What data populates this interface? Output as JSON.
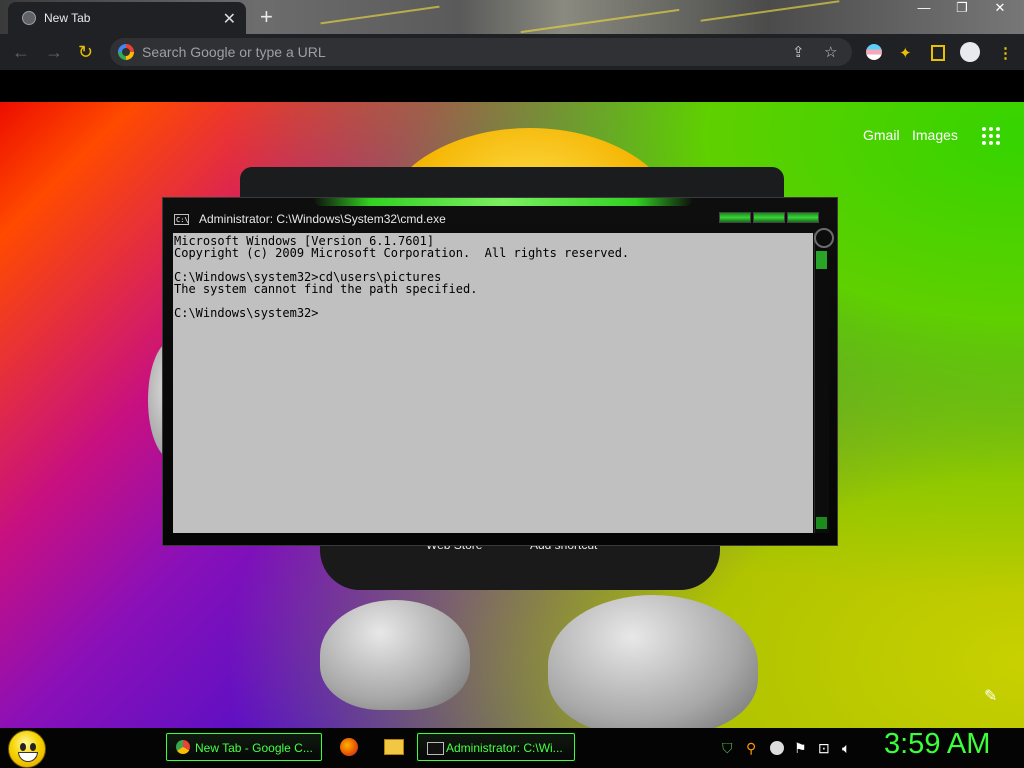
{
  "browser": {
    "tab_title": "New Tab",
    "tab_close": "✕",
    "new_tab": "+",
    "window_controls": [
      "—",
      "❐",
      "✕"
    ],
    "omnibox_placeholder": "Search Google or type a URL",
    "icons": [
      "back-icon",
      "forward-icon",
      "reload-icon",
      "share-icon",
      "star-icon",
      "profile-icon",
      "extensions-icon",
      "sidepanel-icon",
      "account-icon",
      "menu-icon"
    ]
  },
  "newtab_page": {
    "gmail": "Gmail",
    "images": "Images",
    "shortcut_web_store": "Web Store",
    "shortcut_add": "Add shortcut"
  },
  "cmd": {
    "title": "Administrator: C:\\Windows\\System32\\cmd.exe",
    "icon_text": "C:\\",
    "lines": [
      "Microsoft Windows [Version 6.1.7601]",
      "Copyright (c) 2009 Microsoft Corporation.  All rights reserved.",
      "",
      "C:\\Windows\\system32>cd\\users\\pictures",
      "The system cannot find the path specified.",
      "",
      "C:\\Windows\\system32>"
    ]
  },
  "taskbar": {
    "chrome_task": "New Tab - Google C...",
    "cmd_task": "Administrator: C:\\Wi...",
    "clock": "3:59 AM"
  },
  "colors": {
    "accent_green": "#3aff3a",
    "browser_dark": "#202124",
    "console_bg": "#c0c0c0"
  }
}
